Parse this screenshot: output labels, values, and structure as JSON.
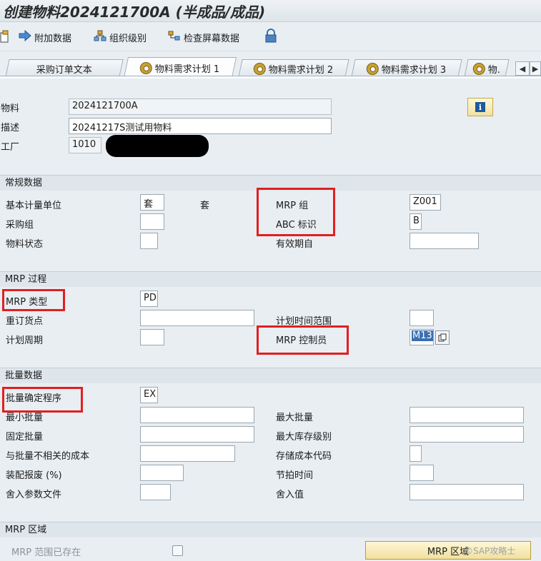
{
  "title": "创建物料2024121700A (半成品/成品)",
  "toolbar": {
    "additional_data": "附加数据",
    "org_levels": "组织级别",
    "check_screen_data": "检查屏幕数据"
  },
  "tabs": [
    {
      "label": "采购订单文本",
      "icon": "none"
    },
    {
      "label": "物料需求计划 1",
      "icon": "mrp-tab-icon"
    },
    {
      "label": "物料需求计划 2",
      "icon": "mrp-tab-icon"
    },
    {
      "label": "物料需求计划 3",
      "icon": "mrp-tab-icon"
    },
    {
      "label": "物.",
      "icon": "mrp-tab-icon"
    }
  ],
  "header": {
    "material_label": "物料",
    "material_value": "2024121700A",
    "desc_label": "描述",
    "desc_value": "20241217S测试用物料",
    "plant_label": "工厂",
    "plant_value": "1010"
  },
  "general": {
    "section": "常规数据",
    "base_uom_label": "基本计量单位",
    "base_uom_value": "套",
    "base_uom_text": "套",
    "purch_group_label": "采购组",
    "material_status_label": "物料状态",
    "mrp_group_label": "MRP 组",
    "mrp_group_value": "Z001",
    "abc_label": "ABC 标识",
    "abc_value": "B",
    "valid_from_label": "有效期自"
  },
  "mrp_process": {
    "section": "MRP 过程",
    "mrp_type_label": "MRP 类型",
    "mrp_type_value": "PD",
    "reorder_label": "重订货点",
    "planning_cycle_label": "计划周期",
    "plan_horizon_label": "计划时间范围",
    "controller_label": "MRP 控制员",
    "controller_value": "M13"
  },
  "lot": {
    "section": "批量数据",
    "procedure_label": "批量确定程序",
    "procedure_value": "EX",
    "min_label": "最小批量",
    "fixed_label": "固定批量",
    "indep_cost_label": "与批量不相关的成本",
    "scrap_label": "装配报废 (%)",
    "round_profile_label": "舍入参数文件",
    "max_label": "最大批量",
    "max_stock_label": "最大库存级别",
    "storage_cost_label": "存储成本代码",
    "takt_label": "节拍时间",
    "round_value_label": "舍入值"
  },
  "mrp_area": {
    "section": "MRP 区域",
    "exists_label": "MRP 范围已存在",
    "button_label": "MRP 区域"
  },
  "watermark": "©SAP攻略士",
  "colors": {
    "highlight_box": "#e02020",
    "selection": "#3a6fb0"
  }
}
